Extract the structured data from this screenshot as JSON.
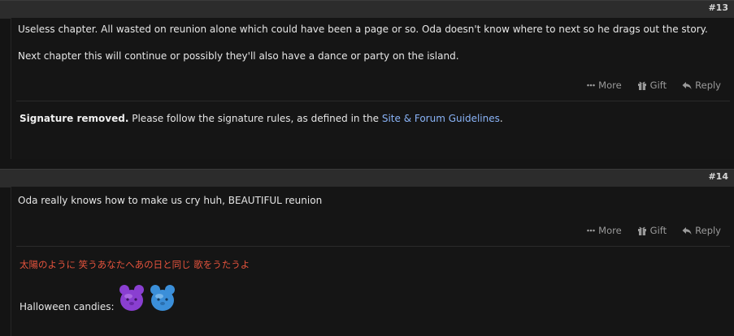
{
  "posts": [
    {
      "number": "#13",
      "lines": [
        "Useless chapter. All wasted on reunion alone which could have been a page or so. Oda doesn't know where to next so he drags out the story.",
        "Next chapter this will continue or possibly they'll also have a dance or party on the island."
      ],
      "signature": {
        "bold": "Signature removed.",
        "text": " Please follow the signature rules, as defined in the ",
        "link": "Site & Forum Guidelines",
        "end": "."
      }
    },
    {
      "number": "#14",
      "lines": [
        "Oda really knows how to make us cry huh, BEAUTIFUL reunion"
      ],
      "signature": {
        "japanese": "太陽のように 笑うあなたへあの日と同じ 歌をうたうよ",
        "candies_label": "Halloween candies:"
      }
    }
  ],
  "actions": {
    "more": "More",
    "gift": "Gift",
    "reply": "Reply"
  },
  "colors": {
    "link": "#8ab4f8",
    "signature_red": "#e5533d",
    "candy_purple": "#8a3fd1",
    "candy_blue": "#3b8fd9"
  }
}
